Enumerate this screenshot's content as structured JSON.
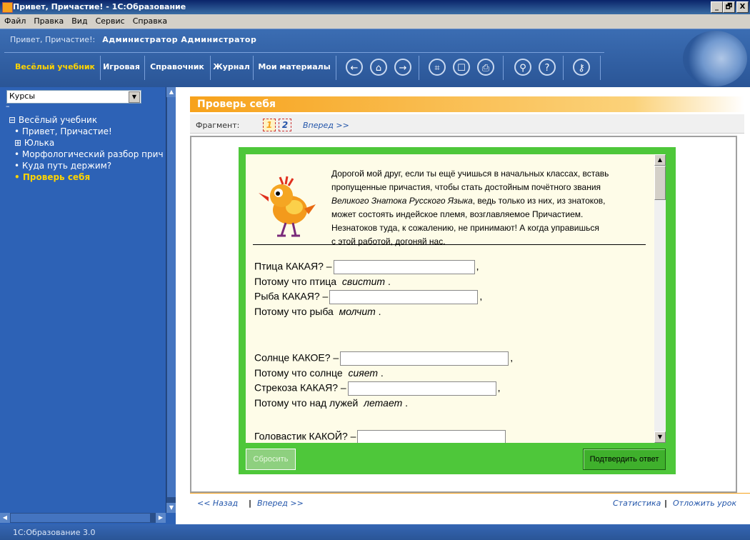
{
  "window": {
    "title": "Привет, Причастие! - 1С:Образование",
    "controls": [
      "_",
      "🗗",
      "X"
    ]
  },
  "menu": [
    "Файл",
    "Правка",
    "Вид",
    "Сервис",
    "Справка"
  ],
  "header": {
    "crumb": "Привет, Причастие!:",
    "user": "Администратор Администратор"
  },
  "nav": {
    "tabs": [
      "Весёлый учебник",
      "Игровая",
      "Справочник",
      "Журнал",
      "Мои материалы"
    ],
    "active_tab": "Весёлый учебник",
    "icons": [
      "back-icon",
      "home-icon",
      "forward-icon",
      "fullscreen-icon",
      "pointer-icon",
      "print-icon",
      "search-icon",
      "help-icon",
      "key-icon"
    ]
  },
  "sidebar": {
    "select_value": "Курсы",
    "tree": [
      {
        "label": "⊟ Весёлый учебник",
        "level": 1
      },
      {
        "label": "• Привет, Причастие!",
        "level": 2
      },
      {
        "label": "⊞ Юлька",
        "level": 2
      },
      {
        "label": "• Морфологический разбор прич",
        "level": 2
      },
      {
        "label": "• Куда путь держим?",
        "level": 2
      },
      {
        "label": "• Проверь себя",
        "level": 2,
        "selected": true
      }
    ]
  },
  "lesson": {
    "title": "Проверь себя",
    "fragment_label": "Фрагмент:",
    "fragments": [
      "1",
      "2"
    ],
    "forward": "Вперед >>",
    "intro_1": "Дорогой мой друг, если ты ещё учишься в начальных классах, вставь",
    "intro_2": "пропущенные причастия, чтобы стать достойным почётного звания",
    "intro_3a": "Великого Знатока Русского Языка",
    "intro_3b": ", ведь только из них, из знатоков,",
    "intro_4": "может состоять индейское племя, возглавляемое Причастием.",
    "intro_5": "Незнатоков туда, к сожалению, не принимают! А когда управишься",
    "intro_6": "с этой работой, догоняй нас.",
    "questions": [
      {
        "q": "Птица КАКАЯ? –",
        "because": "Потому что птица",
        "verb": "свистит"
      },
      {
        "q": "Рыба КАКАЯ? –",
        "because": "Потому что рыба",
        "verb": "молчит"
      },
      {
        "q": "Солнце КАКОЕ? –",
        "because": "Потому что солнце",
        "verb": "сияет"
      },
      {
        "q": "Стрекоза КАКАЯ? –",
        "because": "Потому что над лужей",
        "verb": "летает"
      },
      {
        "q": "Головастик КАКОЙ? –"
      }
    ],
    "reset_button": "Сбросить",
    "confirm_button": "Подтвердить ответ"
  },
  "bottom_nav": {
    "back": "<< Назад",
    "forward": "Вперед >>",
    "stats": "Статистика",
    "postpone": "Отложить урок"
  },
  "status": "1С:Образование 3.0",
  "colors": {
    "header_blue": "#2d62b6",
    "accent_orange": "#f7a21b",
    "active_yellow": "#ffd400",
    "task_green": "#4ec73a"
  }
}
